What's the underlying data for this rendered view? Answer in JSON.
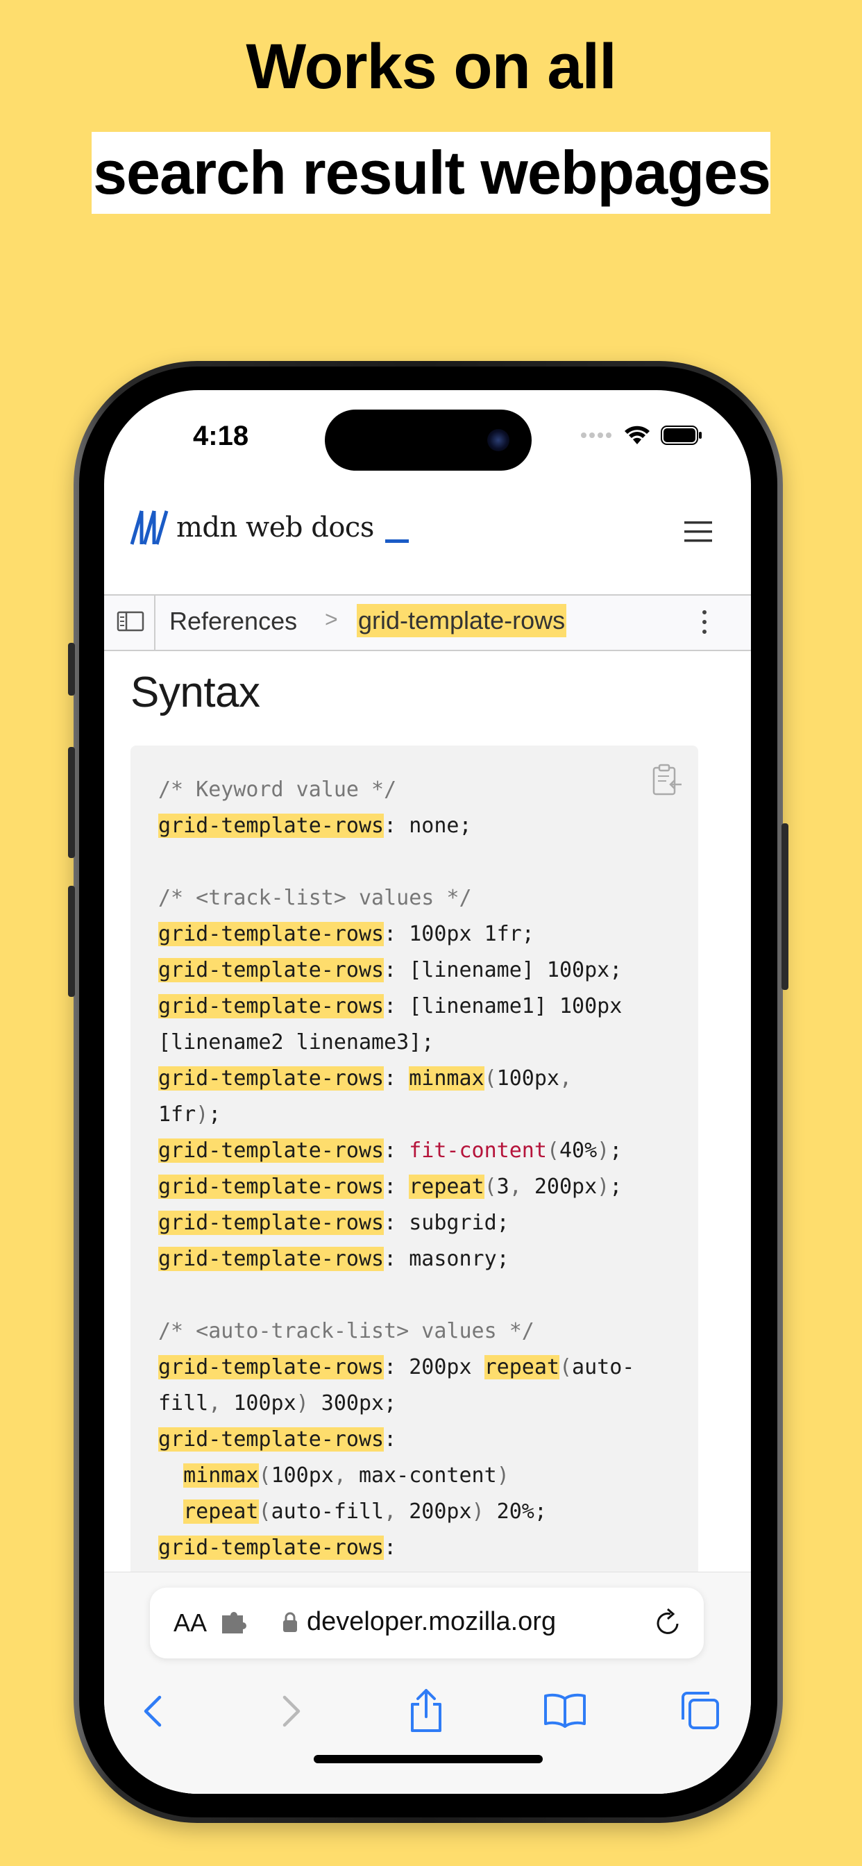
{
  "headline": {
    "line1": "Works on all",
    "line2": "search result webpages"
  },
  "status_bar": {
    "time": "4:18",
    "icons": [
      "signal-icon",
      "wifi-icon",
      "battery-icon"
    ]
  },
  "header": {
    "logo_text": "mdn web docs",
    "menu_icon": "hamburger-menu-icon"
  },
  "breadcrumb": {
    "sidebar_icon": "sidebar-toggle-icon",
    "parent": "References",
    "separator": ">",
    "current": "grid-template-rows",
    "more_icon": "more-vertical-icon"
  },
  "page": {
    "heading": "Syntax"
  },
  "code_block": {
    "copy_icon": "clipboard-copy-icon",
    "lines": [
      "/* Keyword value */",
      "grid-template-rows: none;",
      "",
      "/* <track-list> values */",
      "grid-template-rows: 100px 1fr;",
      "grid-template-rows: [linename] 100px;",
      "grid-template-rows: [linename1] 100px",
      "[linename2 linename3];",
      "grid-template-rows: minmax(100px,",
      "1fr);",
      "grid-template-rows: fit-content(40%);",
      "grid-template-rows: repeat(3, 200px);",
      "grid-template-rows: subgrid;",
      "grid-template-rows: masonry;",
      "",
      "/* <auto-track-list> values */",
      "grid-template-rows: 200px repeat(auto-",
      "fill, 100px) 300px;",
      "grid-template-rows:",
      "  minmax(100px, max-content)",
      "  repeat(auto-fill, 200px) 20%;",
      "grid-template-rows:"
    ]
  },
  "safari": {
    "text_size_label": "AA",
    "extension_icon": "puzzle-extension-icon",
    "lock_icon": "lock-icon",
    "url": "developer.mozilla.org",
    "reload_icon": "reload-icon",
    "toolbar": [
      "back-icon",
      "forward-icon",
      "share-icon",
      "bookmarks-icon",
      "tabs-icon"
    ]
  },
  "colors": {
    "background": "#fedd6d",
    "highlight": "#fedd6d",
    "mdn_blue": "#1a5bc6",
    "safari_blue": "#2f7cf6",
    "function_red": "#b5133a"
  }
}
